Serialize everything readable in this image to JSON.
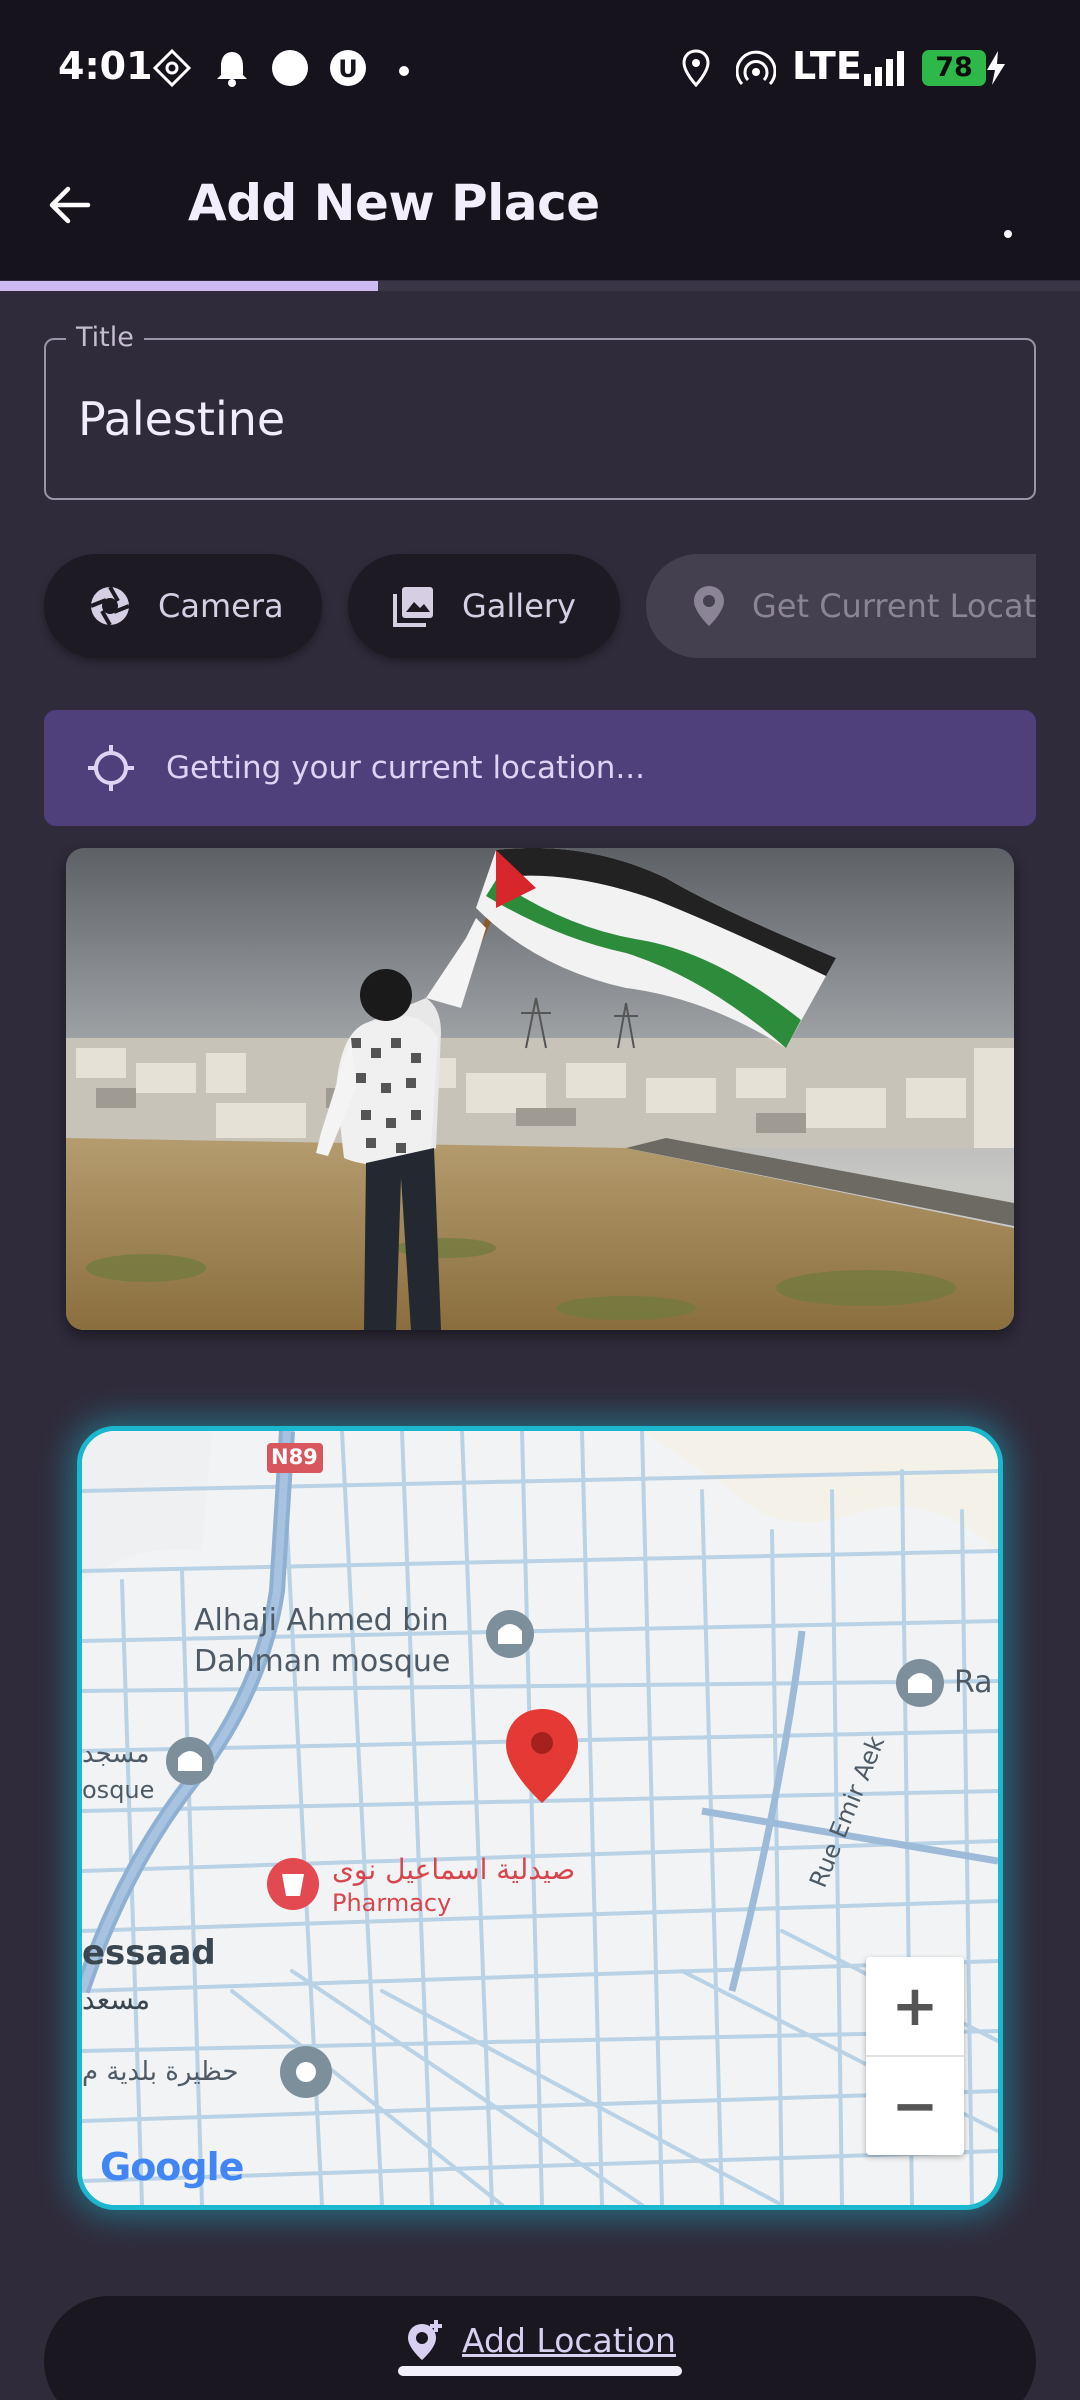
{
  "status_bar": {
    "time": "4:01",
    "network": "LTE",
    "battery": "78"
  },
  "app_bar": {
    "title": "Add New Place",
    "progress": 0.35
  },
  "title_field": {
    "label": "Title",
    "value": "Palestine"
  },
  "actions": {
    "camera": "Camera",
    "gallery": "Gallery",
    "current_location": "Get Current Location"
  },
  "banner": {
    "text": "Getting your current location..."
  },
  "map": {
    "road_label": "N89",
    "poi_mosque_1_line1": "Alhaji Ahmed bin",
    "poi_mosque_1_line2": "Dahman mosque",
    "poi_mosque_2_line1": "مسجد",
    "poi_mosque_2_line2": "osque",
    "poi_edge_right": "Ra",
    "pharmacy_ar": "صيدلية اسماعيل نوى",
    "pharmacy_en": "Pharmacy",
    "street": "Rue Emir Aek",
    "area_en": "essaad",
    "area_ar": "مسعد",
    "poi_ar": "حظيرة بلدية م",
    "logo": "Google",
    "zoom_in": "+",
    "zoom_out": "−"
  },
  "add_button": {
    "label": "Add Location"
  },
  "colors": {
    "accent": "#1bb7cf",
    "banner": "#4f407c",
    "background": "#302b3b",
    "marker": "#e53935"
  }
}
